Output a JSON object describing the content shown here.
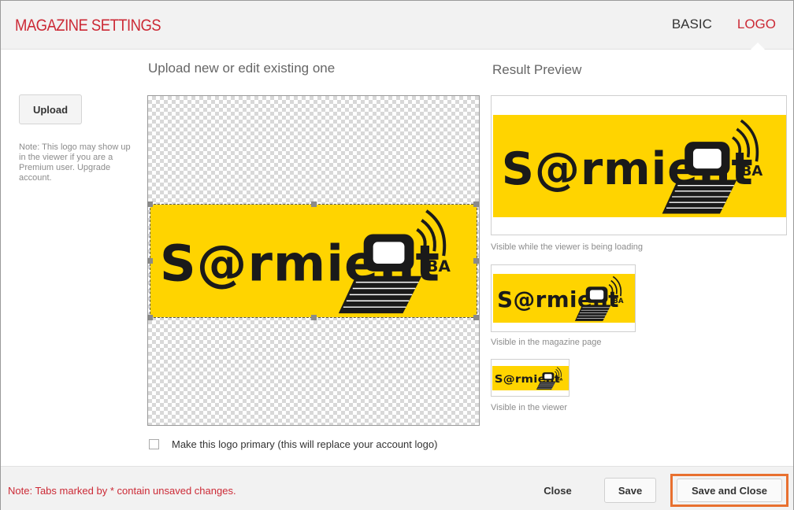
{
  "header": {
    "title": "MAGAZINE SETTINGS",
    "tabs": [
      {
        "label": "BASIC",
        "active": false
      },
      {
        "label": "LOGO",
        "active": true
      }
    ]
  },
  "sidebar": {
    "upload_label": "Upload",
    "note": "Note: This logo may show up in the viewer if you are a Premium user. Upgrade account."
  },
  "editor": {
    "heading": "Upload new or edit existing one",
    "primary_checkbox_label": "Make this logo primary (this will replace your account logo)",
    "primary_checked": false
  },
  "preview": {
    "heading": "Result Preview",
    "items": [
      {
        "caption": "Visible while the viewer is being loading"
      },
      {
        "caption": "Visible in the magazine page"
      },
      {
        "caption": "Visible in the viewer"
      }
    ]
  },
  "logo": {
    "text": "S@rmient",
    "badge": "BA",
    "background": "#ffd400"
  },
  "footer": {
    "note_prefix": "Note: Tabs marked by ",
    "note_star": "*",
    "note_suffix": " contain unsaved changes.",
    "close_label": "Close",
    "save_label": "Save",
    "save_close_label": "Save and Close"
  },
  "colors": {
    "accent": "#cc2a36",
    "highlight": "#e8702f",
    "logo_yellow": "#ffd400"
  }
}
